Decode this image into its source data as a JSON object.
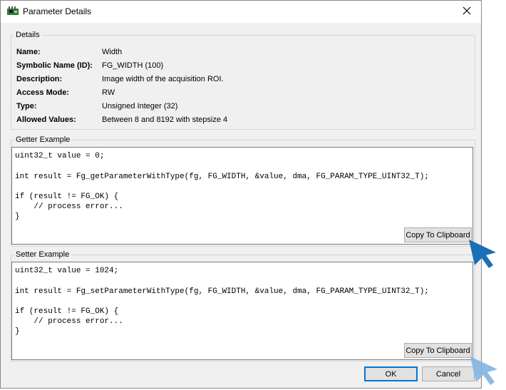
{
  "window": {
    "title": "Parameter Details",
    "app_icon": "board-icon",
    "close_icon": "close-icon"
  },
  "details": {
    "group_title": "Details",
    "rows": [
      {
        "key": "Name:",
        "value": "Width"
      },
      {
        "key": "Symbolic Name (ID):",
        "value": "FG_WIDTH (100)"
      },
      {
        "key": "Description:",
        "value": "Image width of the acquisition ROI."
      },
      {
        "key": "Access Mode:",
        "value": "RW"
      },
      {
        "key": "Type:",
        "value": "Unsigned Integer (32)"
      },
      {
        "key": "Allowed Values:",
        "value": "Between 8 and 8192 with stepsize 4"
      }
    ]
  },
  "getter": {
    "group_title": "Getter Example",
    "code": [
      "uint32_t value = 0;",
      "",
      "int result = Fg_getParameterWithType(fg, FG_WIDTH, &value, dma, FG_PARAM_TYPE_UINT32_T);",
      "",
      "if (result != FG_OK) {",
      "    // process error...",
      "}"
    ],
    "copy_label": "Copy To Clipboard"
  },
  "setter": {
    "group_title": "Setter Example",
    "code": [
      "uint32_t value = 1024;",
      "",
      "int result = Fg_setParameterWithType(fg, FG_WIDTH, &value, dma, FG_PARAM_TYPE_UINT32_T);",
      "",
      "if (result != FG_OK) {",
      "    // process error...",
      "}"
    ],
    "copy_label": "Copy To Clipboard"
  },
  "footer": {
    "ok_label": "OK",
    "cancel_label": "Cancel"
  },
  "colors": {
    "accent": "#0078d7",
    "cursor_dark": "#1a6fb5",
    "cursor_light": "#7fb5e0"
  }
}
